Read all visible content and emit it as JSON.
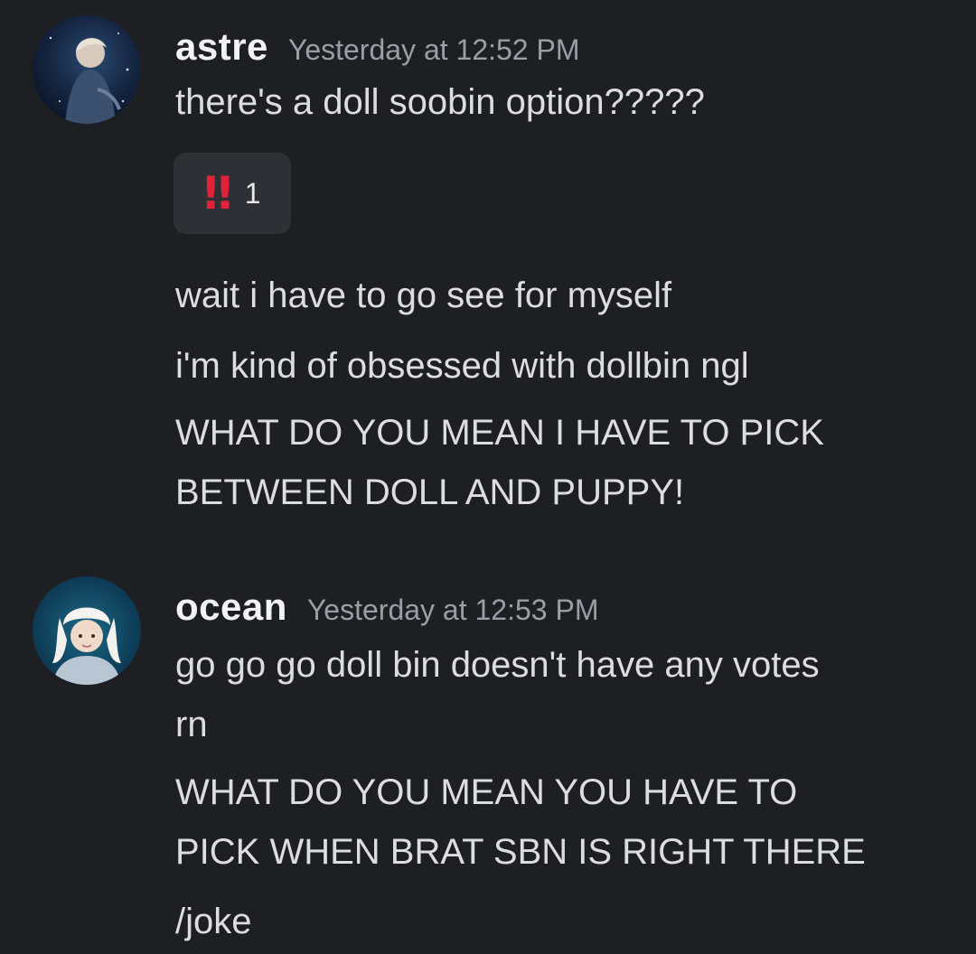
{
  "messages": [
    {
      "username": "astre",
      "timestamp": "Yesterday at 12:52 PM",
      "avatar_icon": "astre-avatar",
      "lines": [
        "there's a doll soobin option?????",
        "wait i have to go see for myself",
        "i'm kind of obsessed with dollbin ngl",
        "WHAT DO YOU MEAN I HAVE TO PICK",
        "BETWEEN DOLL AND PUPPY!"
      ],
      "reaction": {
        "emoji": "‼",
        "emoji_icon": "double-exclamation-icon",
        "count": "1"
      }
    },
    {
      "username": "ocean",
      "timestamp": "Yesterday at 12:53 PM",
      "avatar_icon": "ocean-avatar",
      "lines": [
        "go go go doll bin doesn't have any votes",
        "rn",
        "WHAT DO YOU MEAN YOU HAVE TO",
        "PICK WHEN BRAT SBN IS RIGHT THERE",
        "/joke"
      ]
    }
  ],
  "colors": {
    "background": "#1e1f23",
    "username": "#f2f3f5",
    "timestamp": "#9b9ea6",
    "message_text": "#dcdde1",
    "reaction_bg": "#2e3036",
    "reaction_emoji": "#e0223a"
  }
}
